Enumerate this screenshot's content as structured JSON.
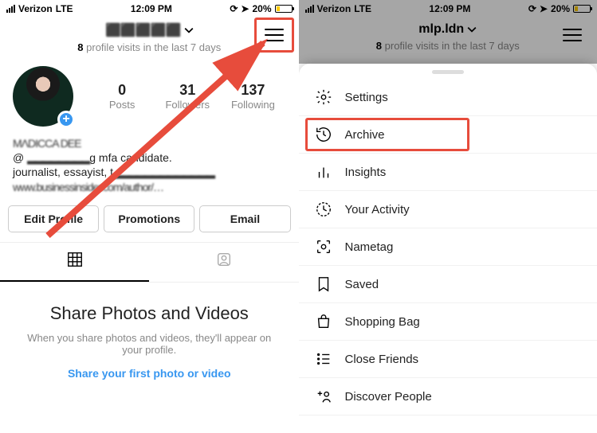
{
  "status": {
    "carrier": "Verizon",
    "network": "LTE",
    "time": "12:09 PM",
    "battery": "20%"
  },
  "left": {
    "username_obscured": "⬛⬛⬛⬛⬛",
    "visits_count": "8",
    "visits_text": "profile visits in the last 7 days",
    "stats": {
      "posts_num": "0",
      "posts_lbl": "Posts",
      "followers_num": "31",
      "followers_lbl": "Followers",
      "following_num": "137",
      "following_lbl": "Following"
    },
    "bio_line1_obscured": "MΛDICCA DEE",
    "bio_line2a": "@ ",
    "bio_line2b": "g mfa candidate.",
    "bio_line3a": "journalist, essayist, t",
    "bio_link_obscured": "www.businessinsider.com/author/…",
    "buttons": {
      "edit": "Edit Profile",
      "promo": "Promotions",
      "email": "Email"
    },
    "empty": {
      "title": "Share Photos and Videos",
      "body": "When you share photos and videos, they'll appear on your profile.",
      "cta": "Share your first photo or video"
    }
  },
  "right": {
    "username": "mlp.ldn",
    "visits_count": "8",
    "visits_text": "profile visits in the last 7 days",
    "menu": {
      "settings": "Settings",
      "archive": "Archive",
      "insights": "Insights",
      "activity": "Your Activity",
      "nametag": "Nametag",
      "saved": "Saved",
      "shopping": "Shopping Bag",
      "close_friends": "Close Friends",
      "discover": "Discover People"
    }
  }
}
